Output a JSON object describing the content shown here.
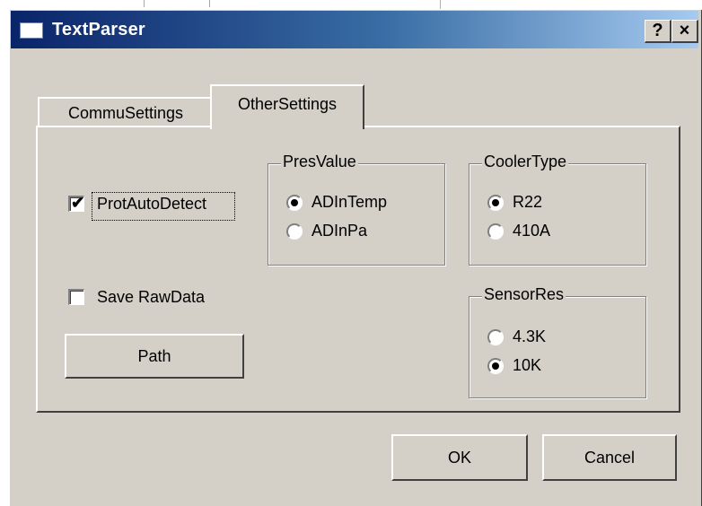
{
  "window": {
    "title": "TextParser",
    "help_label": "?",
    "close_label": "×"
  },
  "tabs": [
    {
      "label": "CommuSettings",
      "selected": false
    },
    {
      "label": "OtherSettings",
      "selected": true
    }
  ],
  "options": {
    "prot_auto_detect": {
      "label": "ProtAutoDetect",
      "checked": true,
      "mark": "✔"
    },
    "save_raw_data": {
      "label": "Save RawData",
      "checked": false
    }
  },
  "path_button": {
    "label": "Path"
  },
  "groups": {
    "pres_value": {
      "title": "PresValue",
      "options": [
        {
          "label": "ADInTemp",
          "selected": true
        },
        {
          "label": "ADInPa",
          "selected": false
        }
      ]
    },
    "cooler_type": {
      "title": "CoolerType",
      "options": [
        {
          "label": "R22",
          "selected": true
        },
        {
          "label": "410A",
          "selected": false
        }
      ]
    },
    "sensor_res": {
      "title": "SensorRes",
      "options": [
        {
          "label": "4.3K",
          "selected": false
        },
        {
          "label": "10K",
          "selected": true
        }
      ]
    }
  },
  "buttons": {
    "ok": "OK",
    "cancel": "Cancel"
  },
  "colors": {
    "face": "#d4d0c8",
    "title_start": "#0a246a",
    "title_end": "#a6caf0"
  }
}
